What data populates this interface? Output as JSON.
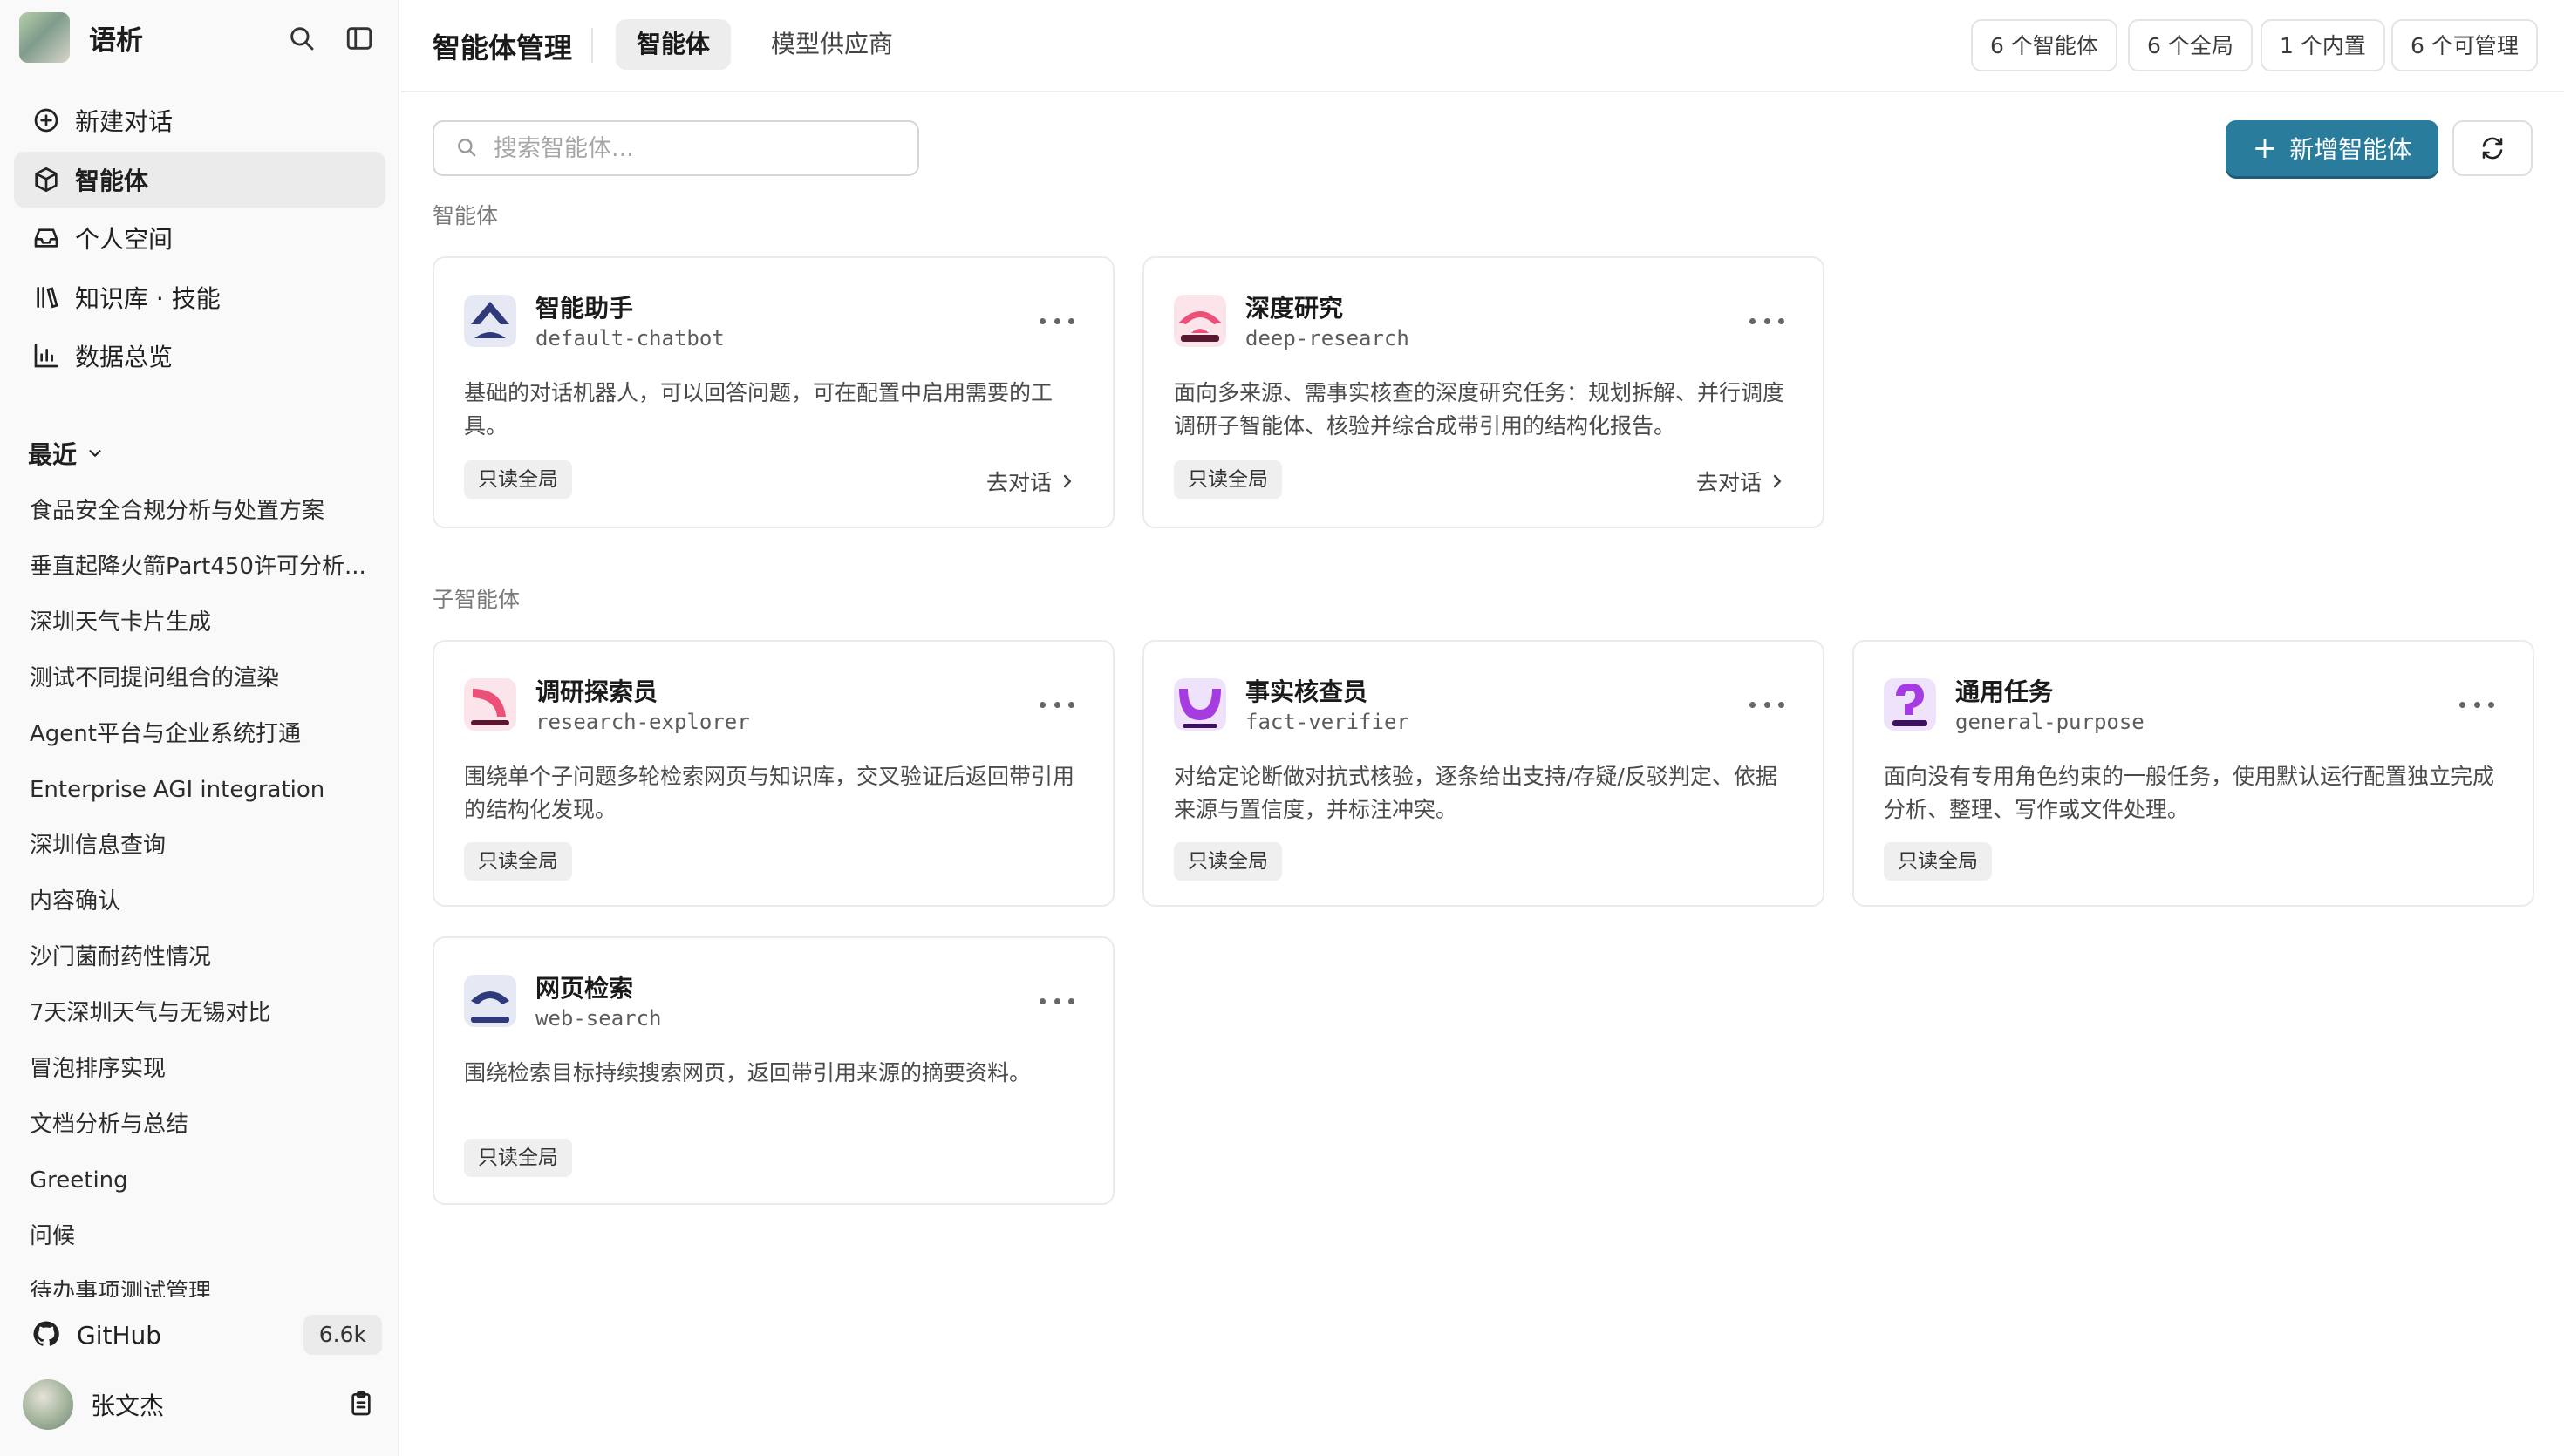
{
  "sidebar": {
    "brand": "语析",
    "nav": [
      {
        "label": "新建对话",
        "icon": "plus-circle-icon"
      },
      {
        "label": "智能体",
        "icon": "cube-icon"
      },
      {
        "label": "个人空间",
        "icon": "inbox-icon"
      },
      {
        "label": "知识库 · 技能",
        "icon": "library-icon"
      },
      {
        "label": "数据总览",
        "icon": "bar-chart-icon"
      }
    ],
    "recent_label": "最近",
    "recent": [
      "食品安全合规分析与处置方案",
      "垂直起降火箭Part450许可分析...",
      "深圳天气卡片生成",
      "测试不同提问组合的渲染",
      "Agent平台与企业系统打通",
      "Enterprise AGI integration",
      "深圳信息查询",
      "内容确认",
      "沙门菌耐药性情况",
      "7天深圳天气与无锡对比",
      "冒泡排序实现",
      "文档分析与总结",
      "Greeting",
      "问候",
      "待办事项测试管理"
    ],
    "github": {
      "label": "GitHub",
      "stars": "6.6k"
    },
    "user": {
      "name": "张文杰"
    }
  },
  "header": {
    "title": "智能体管理",
    "tabs": [
      "智能体",
      "模型供应商"
    ],
    "stats": [
      "6 个智能体",
      "6 个全局",
      "1 个内置",
      "6 个可管理"
    ]
  },
  "toolbar": {
    "search_placeholder": "搜索智能体...",
    "add_label": "新增智能体"
  },
  "sections": {
    "agents_label": "智能体",
    "subagents_label": "子智能体"
  },
  "agents": [
    {
      "name": "智能助手",
      "slug": "default-chatbot",
      "desc": "基础的对话机器人，可以回答问题，可在配置中启用需要的工具。",
      "badge": "只读全局",
      "action": "去对话"
    },
    {
      "name": "深度研究",
      "slug": "deep-research",
      "desc": "面向多来源、需事实核查的深度研究任务：规划拆解、并行调度调研子智能体、核验并综合成带引用的结构化报告。",
      "badge": "只读全局",
      "action": "去对话"
    }
  ],
  "subagents": [
    {
      "name": "调研探索员",
      "slug": "research-explorer",
      "desc": "围绕单个子问题多轮检索网页与知识库，交叉验证后返回带引用的结构化发现。",
      "badge": "只读全局"
    },
    {
      "name": "事实核查员",
      "slug": "fact-verifier",
      "desc": "对给定论断做对抗式核验，逐条给出支持/存疑/反驳判定、依据来源与置信度，并标注冲突。",
      "badge": "只读全局"
    },
    {
      "name": "通用任务",
      "slug": "general-purpose",
      "desc": "面向没有专用角色约束的一般任务，使用默认运行配置独立完成分析、整理、写作或文件处理。",
      "badge": "只读全局"
    },
    {
      "name": "网页检索",
      "slug": "web-search",
      "desc": "围绕检索目标持续搜索网页，返回带引用来源的摘要资料。",
      "badge": "只读全局"
    }
  ],
  "colors": {
    "accent": "#2a7c9c",
    "sidebar_bg": "#f9f9f9",
    "active_nav": "#ebebeb",
    "badge_bg": "#efefef"
  }
}
